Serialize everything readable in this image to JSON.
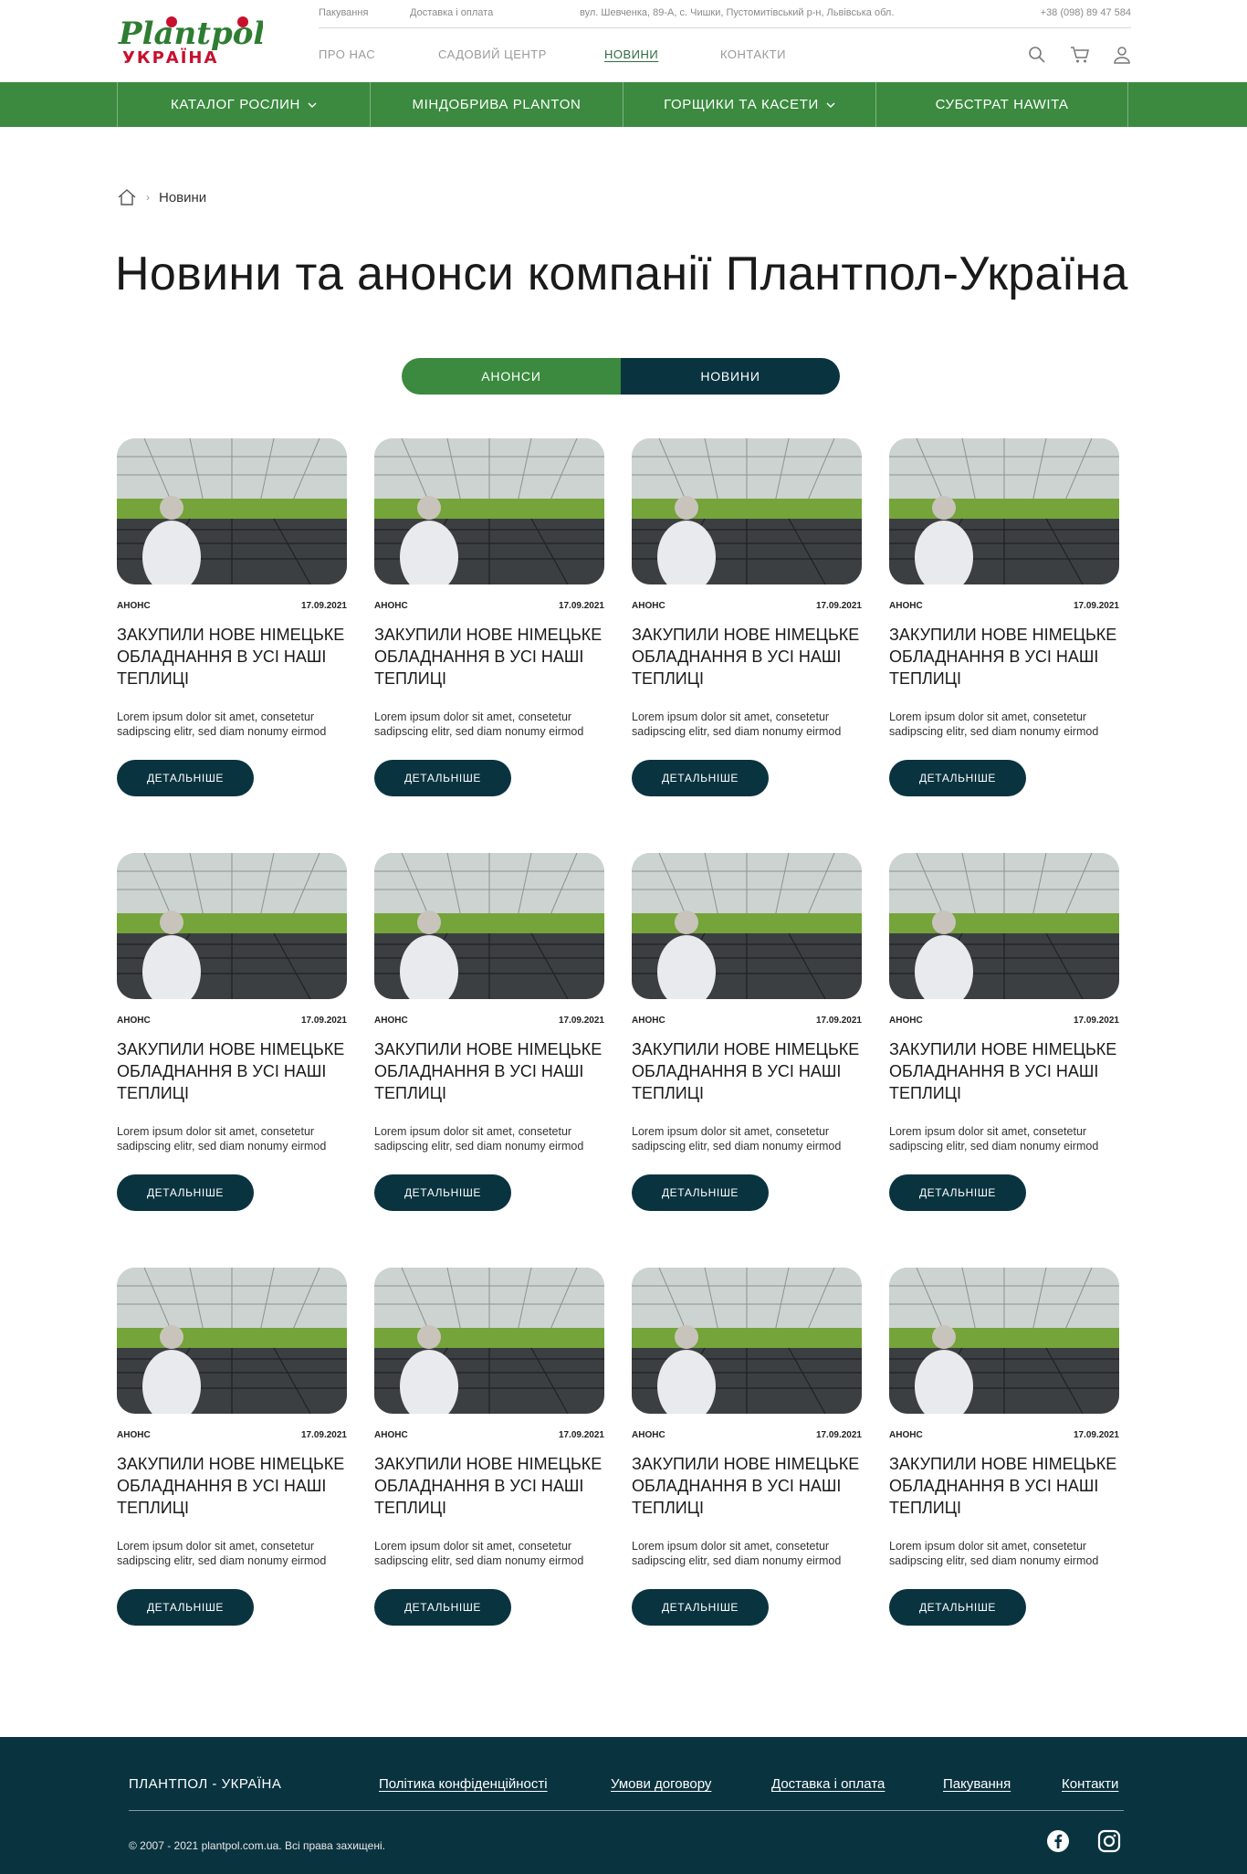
{
  "logo": {
    "line1": "Plantpol",
    "line2": "УКРАЇНА"
  },
  "topbar": {
    "packaging": "Пакування",
    "delivery": "Доставка і оплата",
    "address": "вул. Шевченка, 89-А, с. Чишки, Пустомитівський р-н, Львівська обл.",
    "phone": "+38 (098) 89 47 584"
  },
  "nav": {
    "about": "ПРО НАС",
    "garden": "САДОВИЙ ЦЕНТР",
    "news": "НОВИНИ",
    "contacts": "КОНТАКТИ"
  },
  "icons": {
    "search": "search-icon",
    "cart": "cart-icon",
    "user": "user-icon",
    "home": "home-icon",
    "facebook": "facebook-icon",
    "instagram": "instagram-icon"
  },
  "categories": [
    {
      "label": "КАТАЛОГ РОСЛИН"
    },
    {
      "label": "МІНДОБРИВА PLANTON"
    },
    {
      "label": "ГОРЩИКИ ТА КАСЕТИ"
    },
    {
      "label": "СУБСТРАТ HAWITA"
    }
  ],
  "breadcrumb": {
    "current": "Новини"
  },
  "page": {
    "title": "Новини та анонси компанії Плантпол-Україна"
  },
  "toggle": {
    "left": "АНОНСИ",
    "right": "НОВИНИ"
  },
  "cards": [
    {
      "tag": "АНОНС",
      "date": "17.09.2021",
      "title": "ЗАКУПИЛИ НОВЕ НІМЕЦЬКЕ ОБЛАДНАННЯ В УСІ НАШІ ТЕПЛИЦІ",
      "desc": "Lorem ipsum dolor sit amet, consetetur sadipscing elitr, sed diam nonumy eirmod",
      "button": "ДЕТАЛЬНІШЕ"
    },
    {
      "tag": "АНОНС",
      "date": "17.09.2021",
      "title": "ЗАКУПИЛИ НОВЕ НІМЕЦЬКЕ ОБЛАДНАННЯ В УСІ НАШІ ТЕПЛИЦІ",
      "desc": "Lorem ipsum dolor sit amet, consetetur sadipscing elitr, sed diam nonumy eirmod",
      "button": "ДЕТАЛЬНІШЕ"
    },
    {
      "tag": "АНОНС",
      "date": "17.09.2021",
      "title": "ЗАКУПИЛИ НОВЕ НІМЕЦЬКЕ ОБЛАДНАННЯ В УСІ НАШІ ТЕПЛИЦІ",
      "desc": "Lorem ipsum dolor sit amet, consetetur sadipscing elitr, sed diam nonumy eirmod",
      "button": "ДЕТАЛЬНІШЕ"
    },
    {
      "tag": "АНОНС",
      "date": "17.09.2021",
      "title": "ЗАКУПИЛИ НОВЕ НІМЕЦЬКЕ ОБЛАДНАННЯ В УСІ НАШІ ТЕПЛИЦІ",
      "desc": "Lorem ipsum dolor sit amet, consetetur sadipscing elitr, sed diam nonumy eirmod",
      "button": "ДЕТАЛЬНІШЕ"
    },
    {
      "tag": "АНОНС",
      "date": "17.09.2021",
      "title": "ЗАКУПИЛИ НОВЕ НІМЕЦЬКЕ ОБЛАДНАННЯ В УСІ НАШІ ТЕПЛИЦІ",
      "desc": "Lorem ipsum dolor sit amet, consetetur sadipscing elitr, sed diam nonumy eirmod",
      "button": "ДЕТАЛЬНІШЕ"
    },
    {
      "tag": "АНОНС",
      "date": "17.09.2021",
      "title": "ЗАКУПИЛИ НОВЕ НІМЕЦЬКЕ ОБЛАДНАННЯ В УСІ НАШІ ТЕПЛИЦІ",
      "desc": "Lorem ipsum dolor sit amet, consetetur sadipscing elitr, sed diam nonumy eirmod",
      "button": "ДЕТАЛЬНІШЕ"
    },
    {
      "tag": "АНОНС",
      "date": "17.09.2021",
      "title": "ЗАКУПИЛИ НОВЕ НІМЕЦЬКЕ ОБЛАДНАННЯ В УСІ НАШІ ТЕПЛИЦІ",
      "desc": "Lorem ipsum dolor sit amet, consetetur sadipscing elitr, sed diam nonumy eirmod",
      "button": "ДЕТАЛЬНІШЕ"
    },
    {
      "tag": "АНОНС",
      "date": "17.09.2021",
      "title": "ЗАКУПИЛИ НОВЕ НІМЕЦЬКЕ ОБЛАДНАННЯ В УСІ НАШІ ТЕПЛИЦІ",
      "desc": "Lorem ipsum dolor sit amet, consetetur sadipscing elitr, sed diam nonumy eirmod",
      "button": "ДЕТАЛЬНІШЕ"
    },
    {
      "tag": "АНОНС",
      "date": "17.09.2021",
      "title": "ЗАКУПИЛИ НОВЕ НІМЕЦЬКЕ ОБЛАДНАННЯ В УСІ НАШІ ТЕПЛИЦІ",
      "desc": "Lorem ipsum dolor sit amet, consetetur sadipscing elitr, sed diam nonumy eirmod",
      "button": "ДЕТАЛЬНІШЕ"
    },
    {
      "tag": "АНОНС",
      "date": "17.09.2021",
      "title": "ЗАКУПИЛИ НОВЕ НІМЕЦЬКЕ ОБЛАДНАННЯ В УСІ НАШІ ТЕПЛИЦІ",
      "desc": "Lorem ipsum dolor sit amet, consetetur sadipscing elitr, sed diam nonumy eirmod",
      "button": "ДЕТАЛЬНІШЕ"
    },
    {
      "tag": "АНОНС",
      "date": "17.09.2021",
      "title": "ЗАКУПИЛИ НОВЕ НІМЕЦЬКЕ ОБЛАДНАННЯ В УСІ НАШІ ТЕПЛИЦІ",
      "desc": "Lorem ipsum dolor sit amet, consetetur sadipscing elitr, sed diam nonumy eirmod",
      "button": "ДЕТАЛЬНІШЕ"
    },
    {
      "tag": "АНОНС",
      "date": "17.09.2021",
      "title": "ЗАКУПИЛИ НОВЕ НІМЕЦЬКЕ ОБЛАДНАННЯ В УСІ НАШІ ТЕПЛИЦІ",
      "desc": "Lorem ipsum dolor sit amet, consetetur sadipscing elitr, sed diam nonumy eirmod",
      "button": "ДЕТАЛЬНІШЕ"
    }
  ],
  "footer": {
    "brand": "ПЛАНТПОЛ - УКРАЇНА",
    "links": [
      "Політика конфіденційності",
      "Умови договору",
      "Доставка і оплата",
      "Пакування",
      "Контакти"
    ],
    "copyright": "© 2007 - 2021 plantpol.com.ua. Всі права захищені."
  },
  "colors": {
    "green": "#3b8a3f",
    "dark": "#0a3340",
    "logo_red": "#c8102e",
    "logo_green": "#2e7d32"
  }
}
